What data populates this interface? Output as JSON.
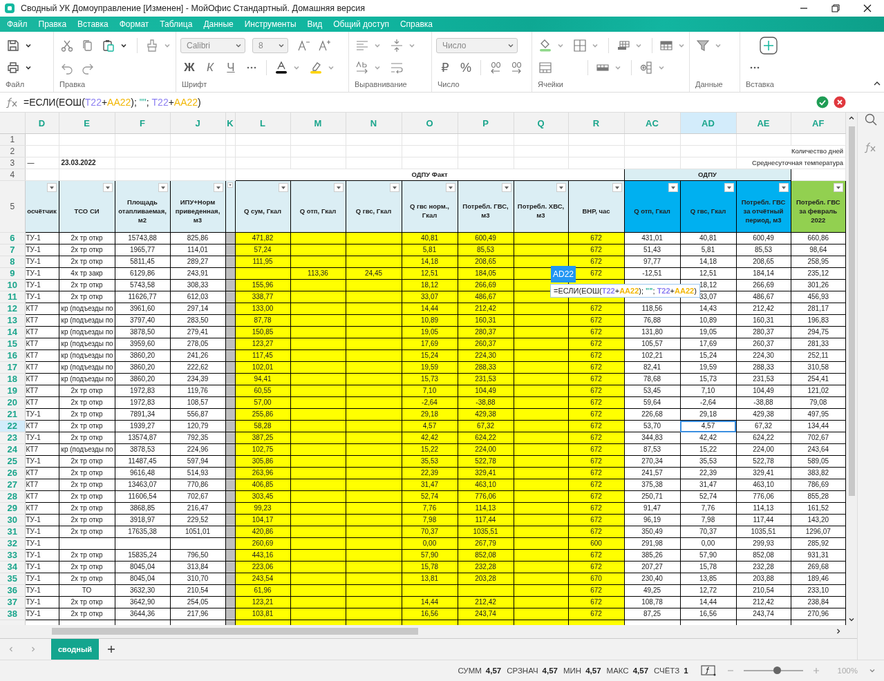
{
  "window": {
    "title": "Сводный УК Домоуправление [Изменен] - МойОфис Стандартный. Домашняя версия"
  },
  "menu": [
    "Файл",
    "Правка",
    "Вставка",
    "Формат",
    "Таблица",
    "Данные",
    "Инструменты",
    "Вид",
    "Общий доступ",
    "Справка"
  ],
  "ribbon": {
    "groups": [
      "Файл",
      "Правка",
      "Шрифт",
      "Выравнивание",
      "Число",
      "Ячейки",
      "Данные",
      "Вставка"
    ],
    "font": "Calibri",
    "size": "8",
    "bold": "Ж",
    "italic": "К",
    "underline": "Ч",
    "number_format": "Число",
    "currency": "₽",
    "percent": "%"
  },
  "formula": [
    {
      "text": "=ЕСЛИ(ЕОШ("
    },
    {
      "text": "T22",
      "color": "#8c7ff2"
    },
    {
      "text": "+"
    },
    {
      "text": "AA22",
      "color": "#f2b705"
    },
    {
      "text": "); "
    },
    {
      "text": "\"\"",
      "color": "#2bb59a"
    },
    {
      "text": "; "
    },
    {
      "text": "T22",
      "color": "#8c7ff2"
    },
    {
      "text": "+"
    },
    {
      "text": "AA22",
      "color": "#f2b705"
    },
    {
      "text": ")"
    }
  ],
  "columns": [
    {
      "letter": "D",
      "kind": "plain",
      "header": "осчётчик",
      "selected": false
    },
    {
      "letter": "E",
      "kind": "plain",
      "header": "ТСО СИ",
      "selected": false
    },
    {
      "letter": "F",
      "kind": "plain",
      "header": "Площадь отапливаемая, м2",
      "selected": false
    },
    {
      "letter": "J",
      "kind": "plain",
      "header": "ИПУ+Норм приведенная, м3",
      "selected": false
    },
    {
      "letter": "K",
      "kind": "spacer",
      "selected": false
    },
    {
      "letter": "L",
      "kind": "fact",
      "header": "Q сум, Гкал",
      "selected": false
    },
    {
      "letter": "M",
      "kind": "fact",
      "header": "Q отп, Гкал",
      "selected": false
    },
    {
      "letter": "N",
      "kind": "fact",
      "header": "Q гвс, Гкал",
      "selected": false
    },
    {
      "letter": "O",
      "kind": "fact",
      "header": "Q гвс норм., Гкал",
      "selected": false
    },
    {
      "letter": "P",
      "kind": "fact",
      "header": "Потребл. ГВС, м3",
      "selected": false
    },
    {
      "letter": "Q",
      "kind": "fact",
      "header": "Потребл. ХВС, м3",
      "selected": false
    },
    {
      "letter": "R",
      "kind": "fact",
      "header": "ВНР, час",
      "selected": false
    },
    {
      "letter": "AC",
      "kind": "odpu",
      "header": "Q отп, Гкал",
      "selected": false
    },
    {
      "letter": "AD",
      "kind": "odpu",
      "header": "Q гвс, Гкал",
      "selected": true
    },
    {
      "letter": "AE",
      "kind": "odpu",
      "header": "Потребл. ГВС за отчётный период, м3",
      "selected": false
    },
    {
      "letter": "AF",
      "kind": "feb",
      "header": "Потребл. ГВС за февраль 2022",
      "selected": false
    }
  ],
  "top_rows": [
    {
      "number": "1",
      "cells": {}
    },
    {
      "number": "2",
      "cells": {},
      "note": "Количество дней"
    },
    {
      "number": "3",
      "cells": {
        "D": "—",
        "E": "23.03.2022"
      },
      "note": "Среднесуточная температура"
    }
  ],
  "group_row": {
    "number": "4",
    "groups": [
      {
        "label": "ОДПУ Факт",
        "kind": "fact"
      },
      {
        "label": "ОДПУ",
        "kind": "odpu"
      }
    ]
  },
  "header_row_number": "5",
  "rows": [
    {
      "number": "6",
      "selected": false,
      "cells": {
        "D": "ТУ-1",
        "E": "2х тр откр",
        "F": "15743,88",
        "J": "825,86",
        "L": "471,82",
        "O": "40,81",
        "P": "600,49",
        "R": "672",
        "AC": "431,01",
        "AD": "40,81",
        "AE": "600,49",
        "AF": "660,86"
      }
    },
    {
      "number": "7",
      "selected": false,
      "cells": {
        "D": "ТУ-1",
        "E": "2х тр откр",
        "F": "1965,77",
        "J": "114,01",
        "L": "57,24",
        "O": "5,81",
        "P": "85,53",
        "R": "672",
        "AC": "51,43",
        "AD": "5,81",
        "AE": "85,53",
        "AF": "98,64"
      }
    },
    {
      "number": "8",
      "selected": false,
      "cells": {
        "D": "ТУ-1",
        "E": "2х тр откр",
        "F": "5811,45",
        "J": "289,27",
        "L": "111,95",
        "O": "14,18",
        "P": "208,65",
        "R": "672",
        "AC": "97,77",
        "AD": "14,18",
        "AE": "208,65",
        "AF": "258,95"
      }
    },
    {
      "number": "9",
      "selected": false,
      "cells": {
        "D": "ТУ-1",
        "E": "4х тр закр",
        "F": "6129,86",
        "J": "243,91",
        "M": "113,36",
        "N": "24,45",
        "O": "12,51",
        "P": "184,05",
        "R": "672",
        "AC": "-12,51",
        "AD": "12,51",
        "AE": "184,14",
        "AF": "235,12"
      }
    },
    {
      "number": "10",
      "selected": false,
      "cells": {
        "D": "ТУ-1",
        "E": "2х тр откр",
        "F": "5743,58",
        "J": "308,33",
        "L": "155,96",
        "O": "18,12",
        "P": "266,69",
        "AD": "18,12",
        "AE": "266,69",
        "AF": "301,26"
      }
    },
    {
      "number": "11",
      "selected": false,
      "cells": {
        "D": "ТУ-1",
        "E": "2х тр откр",
        "F": "11626,77",
        "J": "612,03",
        "L": "338,77",
        "O": "33,07",
        "P": "486,67",
        "AD": "33,07",
        "AE": "486,67",
        "AF": "456,93"
      }
    },
    {
      "number": "12",
      "selected": false,
      "cells": {
        "D": "КТ7",
        "E": "кр (подъезды по",
        "F": "3961,60",
        "J": "297,14",
        "L": "133,00",
        "O": "14,44",
        "P": "212,42",
        "R": "672",
        "AC": "118,56",
        "AD": "14,43",
        "AE": "212,42",
        "AF": "281,17"
      }
    },
    {
      "number": "13",
      "selected": false,
      "cells": {
        "D": "КТ7",
        "E": "кр (подъезды по",
        "F": "3797,40",
        "J": "283,50",
        "L": "87,78",
        "O": "10,89",
        "P": "160,31",
        "R": "672",
        "AC": "76,88",
        "AD": "10,89",
        "AE": "160,31",
        "AF": "196,83"
      }
    },
    {
      "number": "14",
      "selected": false,
      "cells": {
        "D": "КТ7",
        "E": "кр (подъезды по",
        "F": "3878,50",
        "J": "279,41",
        "L": "150,85",
        "O": "19,05",
        "P": "280,37",
        "R": "672",
        "AC": "131,80",
        "AD": "19,05",
        "AE": "280,37",
        "AF": "294,75"
      }
    },
    {
      "number": "15",
      "selected": false,
      "cells": {
        "D": "КТ7",
        "E": "кр (подъезды по",
        "F": "3959,60",
        "J": "278,05",
        "L": "123,27",
        "O": "17,69",
        "P": "260,37",
        "R": "672",
        "AC": "105,57",
        "AD": "17,69",
        "AE": "260,37",
        "AF": "281,33"
      }
    },
    {
      "number": "16",
      "selected": false,
      "cells": {
        "D": "КТ7",
        "E": "кр (подъезды по",
        "F": "3860,20",
        "J": "241,26",
        "L": "117,45",
        "O": "15,24",
        "P": "224,30",
        "R": "672",
        "AC": "102,21",
        "AD": "15,24",
        "AE": "224,30",
        "AF": "252,11"
      }
    },
    {
      "number": "17",
      "selected": false,
      "cells": {
        "D": "КТ7",
        "E": "кр (подъезды по",
        "F": "3860,20",
        "J": "222,62",
        "L": "102,01",
        "O": "19,59",
        "P": "288,33",
        "R": "672",
        "AC": "82,41",
        "AD": "19,59",
        "AE": "288,33",
        "AF": "310,58"
      }
    },
    {
      "number": "18",
      "selected": false,
      "cells": {
        "D": "КТ7",
        "E": "кр (подъезды по",
        "F": "3860,20",
        "J": "234,39",
        "L": "94,41",
        "O": "15,73",
        "P": "231,53",
        "R": "672",
        "AC": "78,68",
        "AD": "15,73",
        "AE": "231,53",
        "AF": "254,41"
      }
    },
    {
      "number": "19",
      "selected": false,
      "cells": {
        "D": "КТ7",
        "E": "2х тр откр",
        "F": "1972,83",
        "J": "119,76",
        "L": "60,55",
        "O": "7,10",
        "P": "104,49",
        "R": "672",
        "AC": "53,45",
        "AD": "7,10",
        "AE": "104,49",
        "AF": "121,02"
      }
    },
    {
      "number": "20",
      "selected": false,
      "cells": {
        "D": "КТ7",
        "E": "2х тр откр",
        "F": "1972,83",
        "J": "108,57",
        "L": "57,00",
        "O": "-2,64",
        "P": "-38,88",
        "R": "672",
        "AC": "59,64",
        "AD": "-2,64",
        "AE": "-38,88",
        "AF": "79,08"
      }
    },
    {
      "number": "21",
      "selected": false,
      "cells": {
        "D": "ТУ-1",
        "E": "2х тр откр",
        "F": "7891,34",
        "J": "556,87",
        "L": "255,86",
        "O": "29,18",
        "P": "429,38",
        "R": "672",
        "AC": "226,68",
        "AD": "29,18",
        "AE": "429,38",
        "AF": "497,95"
      }
    },
    {
      "number": "22",
      "selected": true,
      "cells": {
        "D": "КТ7",
        "E": "2х тр откр",
        "F": "1939,27",
        "J": "120,79",
        "L": "58,28",
        "O": "4,57",
        "P": "67,32",
        "R": "672",
        "AC": "53,70",
        "AD": "4,57",
        "AE": "67,32",
        "AF": "134,44"
      }
    },
    {
      "number": "23",
      "selected": false,
      "cells": {
        "D": "ТУ-1",
        "E": "2х тр откр",
        "F": "13574,87",
        "J": "792,35",
        "L": "387,25",
        "O": "42,42",
        "P": "624,22",
        "R": "672",
        "AC": "344,83",
        "AD": "42,42",
        "AE": "624,22",
        "AF": "702,67"
      }
    },
    {
      "number": "24",
      "selected": false,
      "cells": {
        "D": "КТ7",
        "E": "кр (подъезды по",
        "F": "3878,53",
        "J": "224,96",
        "L": "102,75",
        "O": "15,22",
        "P": "224,00",
        "R": "672",
        "AC": "87,53",
        "AD": "15,22",
        "AE": "224,00",
        "AF": "243,64"
      }
    },
    {
      "number": "25",
      "selected": false,
      "cells": {
        "D": "ТУ-1",
        "E": "2х тр откр",
        "F": "11487,45",
        "J": "597,94",
        "L": "305,86",
        "O": "35,53",
        "P": "522,78",
        "R": "672",
        "AC": "270,34",
        "AD": "35,53",
        "AE": "522,78",
        "AF": "589,05"
      }
    },
    {
      "number": "26",
      "selected": false,
      "cells": {
        "D": "КТ7",
        "E": "2х тр откр",
        "F": "9616,48",
        "J": "514,93",
        "L": "263,96",
        "O": "22,39",
        "P": "329,41",
        "R": "672",
        "AC": "241,57",
        "AD": "22,39",
        "AE": "329,41",
        "AF": "383,82"
      }
    },
    {
      "number": "27",
      "selected": false,
      "cells": {
        "D": "КТ7",
        "E": "2х тр откр",
        "F": "13463,07",
        "J": "770,86",
        "L": "406,85",
        "O": "31,47",
        "P": "463,10",
        "R": "672",
        "AC": "375,38",
        "AD": "31,47",
        "AE": "463,10",
        "AF": "786,69"
      }
    },
    {
      "number": "28",
      "selected": false,
      "cells": {
        "D": "КТ7",
        "E": "2х тр откр",
        "F": "11606,54",
        "J": "702,67",
        "L": "303,45",
        "O": "52,74",
        "P": "776,06",
        "R": "672",
        "AC": "250,71",
        "AD": "52,74",
        "AE": "776,06",
        "AF": "855,28"
      }
    },
    {
      "number": "29",
      "selected": false,
      "cells": {
        "D": "КТ7",
        "E": "2х тр откр",
        "F": "3868,85",
        "J": "216,47",
        "L": "99,23",
        "O": "7,76",
        "P": "114,13",
        "R": "672",
        "AC": "91,47",
        "AD": "7,76",
        "AE": "114,13",
        "AF": "161,52"
      }
    },
    {
      "number": "30",
      "selected": false,
      "cells": {
        "D": "ТУ-1",
        "E": "2х тр откр",
        "F": "3918,97",
        "J": "229,52",
        "L": "104,17",
        "O": "7,98",
        "P": "117,44",
        "R": "672",
        "AC": "96,19",
        "AD": "7,98",
        "AE": "117,44",
        "AF": "143,20"
      }
    },
    {
      "number": "31",
      "selected": false,
      "cells": {
        "D": "ТУ-1",
        "E": "2х тр откр",
        "F": "17635,38",
        "J": "1051,01",
        "L": "420,86",
        "O": "70,37",
        "P": "1035,51",
        "R": "672",
        "AC": "350,49",
        "AD": "70,37",
        "AE": "1035,51",
        "AF": "1296,07"
      }
    },
    {
      "number": "32",
      "selected": false,
      "cells": {
        "D": "ТУ-1",
        "L": "260,69",
        "O": "0,00",
        "P": "267,79",
        "R": "600",
        "AC": "291,98",
        "AD": "0,00",
        "AE": "299,93",
        "AF": "285,92"
      }
    },
    {
      "number": "33",
      "selected": false,
      "cells": {
        "D": "ТУ-1",
        "E": "2х тр откр",
        "F": "15835,24",
        "J": "796,50",
        "L": "443,16",
        "O": "57,90",
        "P": "852,08",
        "R": "672",
        "AC": "385,26",
        "AD": "57,90",
        "AE": "852,08",
        "AF": "931,31"
      }
    },
    {
      "number": "34",
      "selected": false,
      "cells": {
        "D": "ТУ-1",
        "E": "2х тр откр",
        "F": "8045,04",
        "J": "313,84",
        "L": "223,06",
        "O": "15,78",
        "P": "232,28",
        "R": "672",
        "AC": "207,27",
        "AD": "15,78",
        "AE": "232,28",
        "AF": "269,68"
      }
    },
    {
      "number": "35",
      "selected": false,
      "cells": {
        "D": "ТУ-1",
        "E": "2х тр откр",
        "F": "8045,04",
        "J": "310,70",
        "L": "243,54",
        "O": "13,81",
        "P": "203,28",
        "R": "670",
        "AC": "230,40",
        "AD": "13,85",
        "AE": "203,88",
        "AF": "189,46"
      }
    },
    {
      "number": "36",
      "selected": false,
      "cells": {
        "D": "ТУ-1",
        "E": "ТО",
        "F": "3632,30",
        "J": "210,54",
        "L": "61,96",
        "R": "672",
        "AC": "49,25",
        "AD": "12,72",
        "AE": "210,54",
        "AF": "233,10"
      }
    },
    {
      "number": "37",
      "selected": false,
      "cells": {
        "D": "ТУ-1",
        "E": "2х тр откр",
        "F": "3642,90",
        "J": "254,05",
        "L": "123,21",
        "O": "14,44",
        "P": "212,42",
        "R": "672",
        "AC": "108,78",
        "AD": "14,44",
        "AE": "212,42",
        "AF": "238,84"
      }
    },
    {
      "number": "38",
      "selected": false,
      "cells": {
        "D": "ТУ-1",
        "E": "2х тр откр",
        "F": "3644,36",
        "J": "217,96",
        "L": "103,81",
        "O": "16,56",
        "P": "243,74",
        "R": "672",
        "AC": "87,25",
        "AD": "16,56",
        "AE": "243,74",
        "AF": "270,96"
      }
    }
  ],
  "cell_tooltip": {
    "cell": "AD22",
    "formula": [
      {
        "text": "=ЕСЛИ(ЕОШ("
      },
      {
        "text": "T22",
        "color": "#8c7ff2"
      },
      {
        "text": "+"
      },
      {
        "text": "AA22",
        "color": "#f2b705"
      },
      {
        "text": "); "
      },
      {
        "text": "\"\"",
        "color": "#2bb59a"
      },
      {
        "text": "; "
      },
      {
        "text": "T22",
        "color": "#8c7ff2"
      },
      {
        "text": "+"
      },
      {
        "text": "AA22",
        "color": "#f2b705"
      },
      {
        "text": ")"
      }
    ]
  },
  "sheet_tabs": [
    {
      "label": "сводный",
      "selected": true
    }
  ],
  "status_bar": {
    "stats": [
      {
        "label": "СУММ",
        "value": "4,57"
      },
      {
        "label": "СРЗНАЧ",
        "value": "4,57"
      },
      {
        "label": "МИН",
        "value": "4,57"
      },
      {
        "label": "МАКС",
        "value": "4,57"
      },
      {
        "label": "СЧЁТЗ",
        "value": "1"
      }
    ],
    "zoom": {
      "level": 0.56,
      "reading": "100%"
    }
  }
}
